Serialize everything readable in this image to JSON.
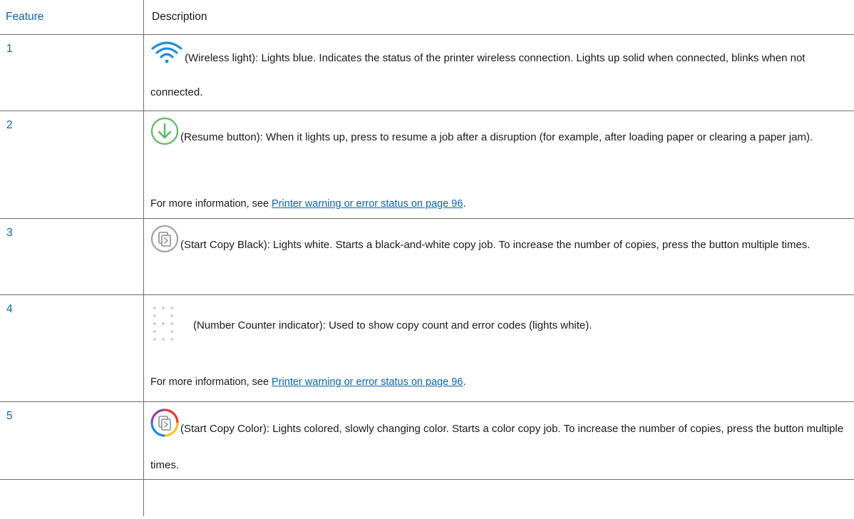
{
  "table": {
    "headers": {
      "feature": "Feature",
      "description": "Description"
    },
    "rows": [
      {
        "feature": "1",
        "icon": "wireless-icon",
        "text": "(Wireless light): Lights blue. Indicates the status of the printer wireless connection. Lights up solid when connected, blinks when not connected."
      },
      {
        "feature": "2",
        "icon": "resume-button-icon",
        "text": "(Resume button): When it lights up, press to resume a job after a disruption (for example, after loading paper or clearing a paper jam).",
        "note_prefix": "For more information, see ",
        "link": "Printer warning or error status on page 96",
        "note_suffix": "."
      },
      {
        "feature": "3",
        "icon": "start-copy-black-icon",
        "text": "(Start Copy Black): Lights white. Starts a black-and-white copy job. To increase the number of copies, press the button multiple times."
      },
      {
        "feature": "4",
        "icon": "number-counter-icon",
        "text": "(Number Counter indicator): Used to show copy count and error codes (lights white).",
        "note_prefix": "For more information, see ",
        "link": "Printer warning or error status on page 96",
        "note_suffix": "."
      },
      {
        "feature": "5",
        "icon": "start-copy-color-icon",
        "text": "(Start Copy Color): Lights colored, slowly changing color. Starts a color copy job. To increase the number of copies, press the button multiple times."
      }
    ]
  },
  "colors": {
    "accent": "#0a64a8",
    "resume_green": "#5cb85c",
    "rule": "#6e6e6e"
  }
}
